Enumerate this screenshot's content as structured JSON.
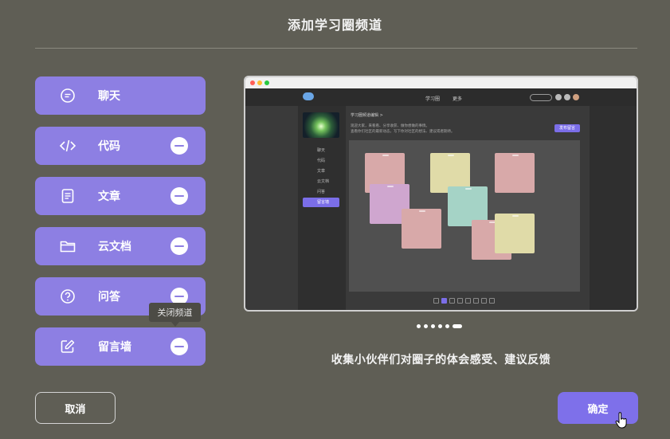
{
  "dialog": {
    "title": "添加学习圈频道",
    "caption": "收集小伙伴们对圈子的体会感受、建议反馈",
    "cancel_label": "取消",
    "confirm_label": "确定",
    "accent_color": "#8d7fe3"
  },
  "channels": [
    {
      "label": "聊天",
      "icon": "chat-bubble-icon",
      "removable": false
    },
    {
      "label": "代码",
      "icon": "code-icon",
      "removable": true
    },
    {
      "label": "文章",
      "icon": "document-icon",
      "removable": true
    },
    {
      "label": "云文档",
      "icon": "folder-icon",
      "removable": true
    },
    {
      "label": "问答",
      "icon": "question-icon",
      "removable": true
    },
    {
      "label": "留言墙",
      "icon": "edit-icon",
      "removable": true
    }
  ],
  "tooltip": {
    "text": "关闭频道"
  },
  "preview": {
    "nav_tab_1": "学习圈",
    "nav_tab_2": "更多",
    "breadcrumb": "学习圈频道编辑 >",
    "description_line_1": "观迎大家，来看看、分享收获、做你想做的事情。",
    "description_line_2": "查看你们社区的最新动态，写下你对社区的想法、建议或者期待。",
    "action_button": "发布留言",
    "menu": [
      "聊天",
      "代码",
      "文章",
      "云文档",
      "问答",
      "留言墙"
    ],
    "note_colors": [
      "#d8a9a9",
      "#e0dba8",
      "#d8a9a9",
      "#cfa6cf",
      "#a5d3c6",
      "#d8a9a9",
      "#d8a9a9",
      "#e0dba8"
    ],
    "pager": [
      "1",
      "2",
      "3",
      "4",
      "5",
      "6",
      "7",
      "8"
    ]
  },
  "slides": {
    "count": 6,
    "active_index": 5
  }
}
